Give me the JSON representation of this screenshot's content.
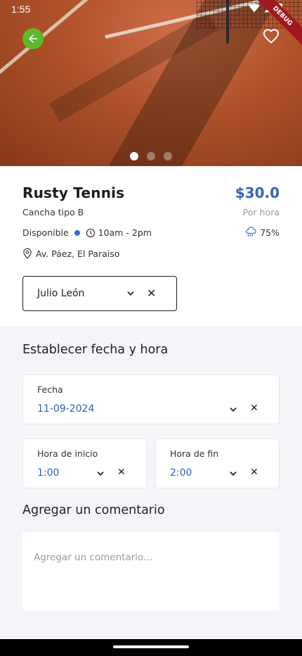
{
  "status_bar": {
    "time": "1:55",
    "debug_label": "DEBUG"
  },
  "hero": {
    "image_icon": "tennis-court-photo",
    "slides": 3,
    "active_slide": 0
  },
  "court": {
    "name": "Rusty Tennis",
    "price": "$30.0",
    "type": "Cancha tipo B",
    "price_unit": "Por hora",
    "availability": "Disponible",
    "hours": "10am - 2pm",
    "rain_chance": "75%",
    "address": "Av. Páez, El Paraiso"
  },
  "player_select": {
    "value": "Julio León"
  },
  "schedule": {
    "section_title": "Establecer fecha y hora",
    "date_label": "Fecha",
    "date_value": "11-09-2024",
    "start_label": "Hora de inicio",
    "start_value": "1:00",
    "end_label": "Hora de fin",
    "end_value": "2:00"
  },
  "comment": {
    "section_title": "Agregar un comentario",
    "placeholder": "Agregar un comentario..."
  },
  "colors": {
    "accent_blue": "#3366b5",
    "back_button_green": "#5db82b",
    "availability_dot": "#2f6fd1"
  }
}
